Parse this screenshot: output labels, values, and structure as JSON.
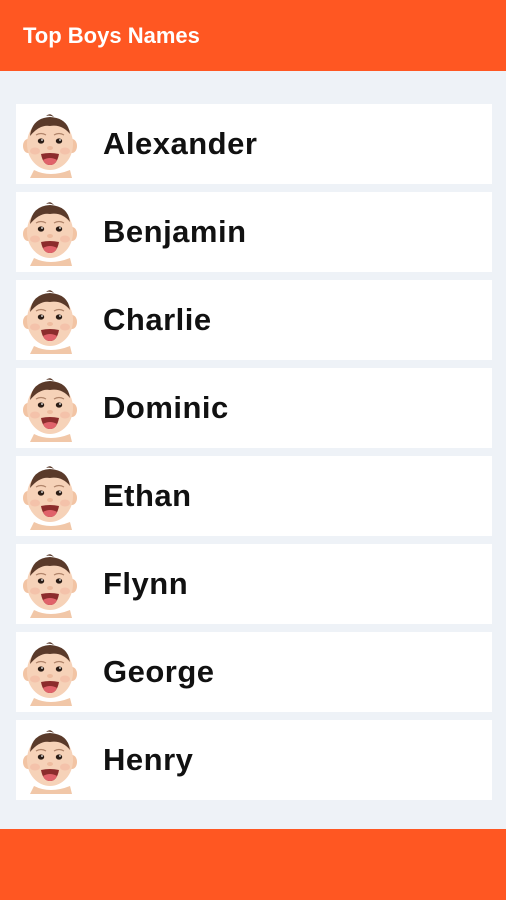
{
  "app_bar": {
    "title": "Top Boys Names",
    "color": "#ff5722"
  },
  "names": [
    {
      "label": "Alexander",
      "icon": "baby-face-icon"
    },
    {
      "label": "Benjamin",
      "icon": "baby-face-icon"
    },
    {
      "label": "Charlie",
      "icon": "baby-face-icon"
    },
    {
      "label": "Dominic",
      "icon": "baby-face-icon"
    },
    {
      "label": "Ethan",
      "icon": "baby-face-icon"
    },
    {
      "label": "Flynn",
      "icon": "baby-face-icon"
    },
    {
      "label": "George",
      "icon": "baby-face-icon"
    },
    {
      "label": "Henry",
      "icon": "baby-face-icon"
    }
  ],
  "colors": {
    "background": "#eef2f7",
    "row_background": "#ffffff",
    "text": "#111111"
  }
}
